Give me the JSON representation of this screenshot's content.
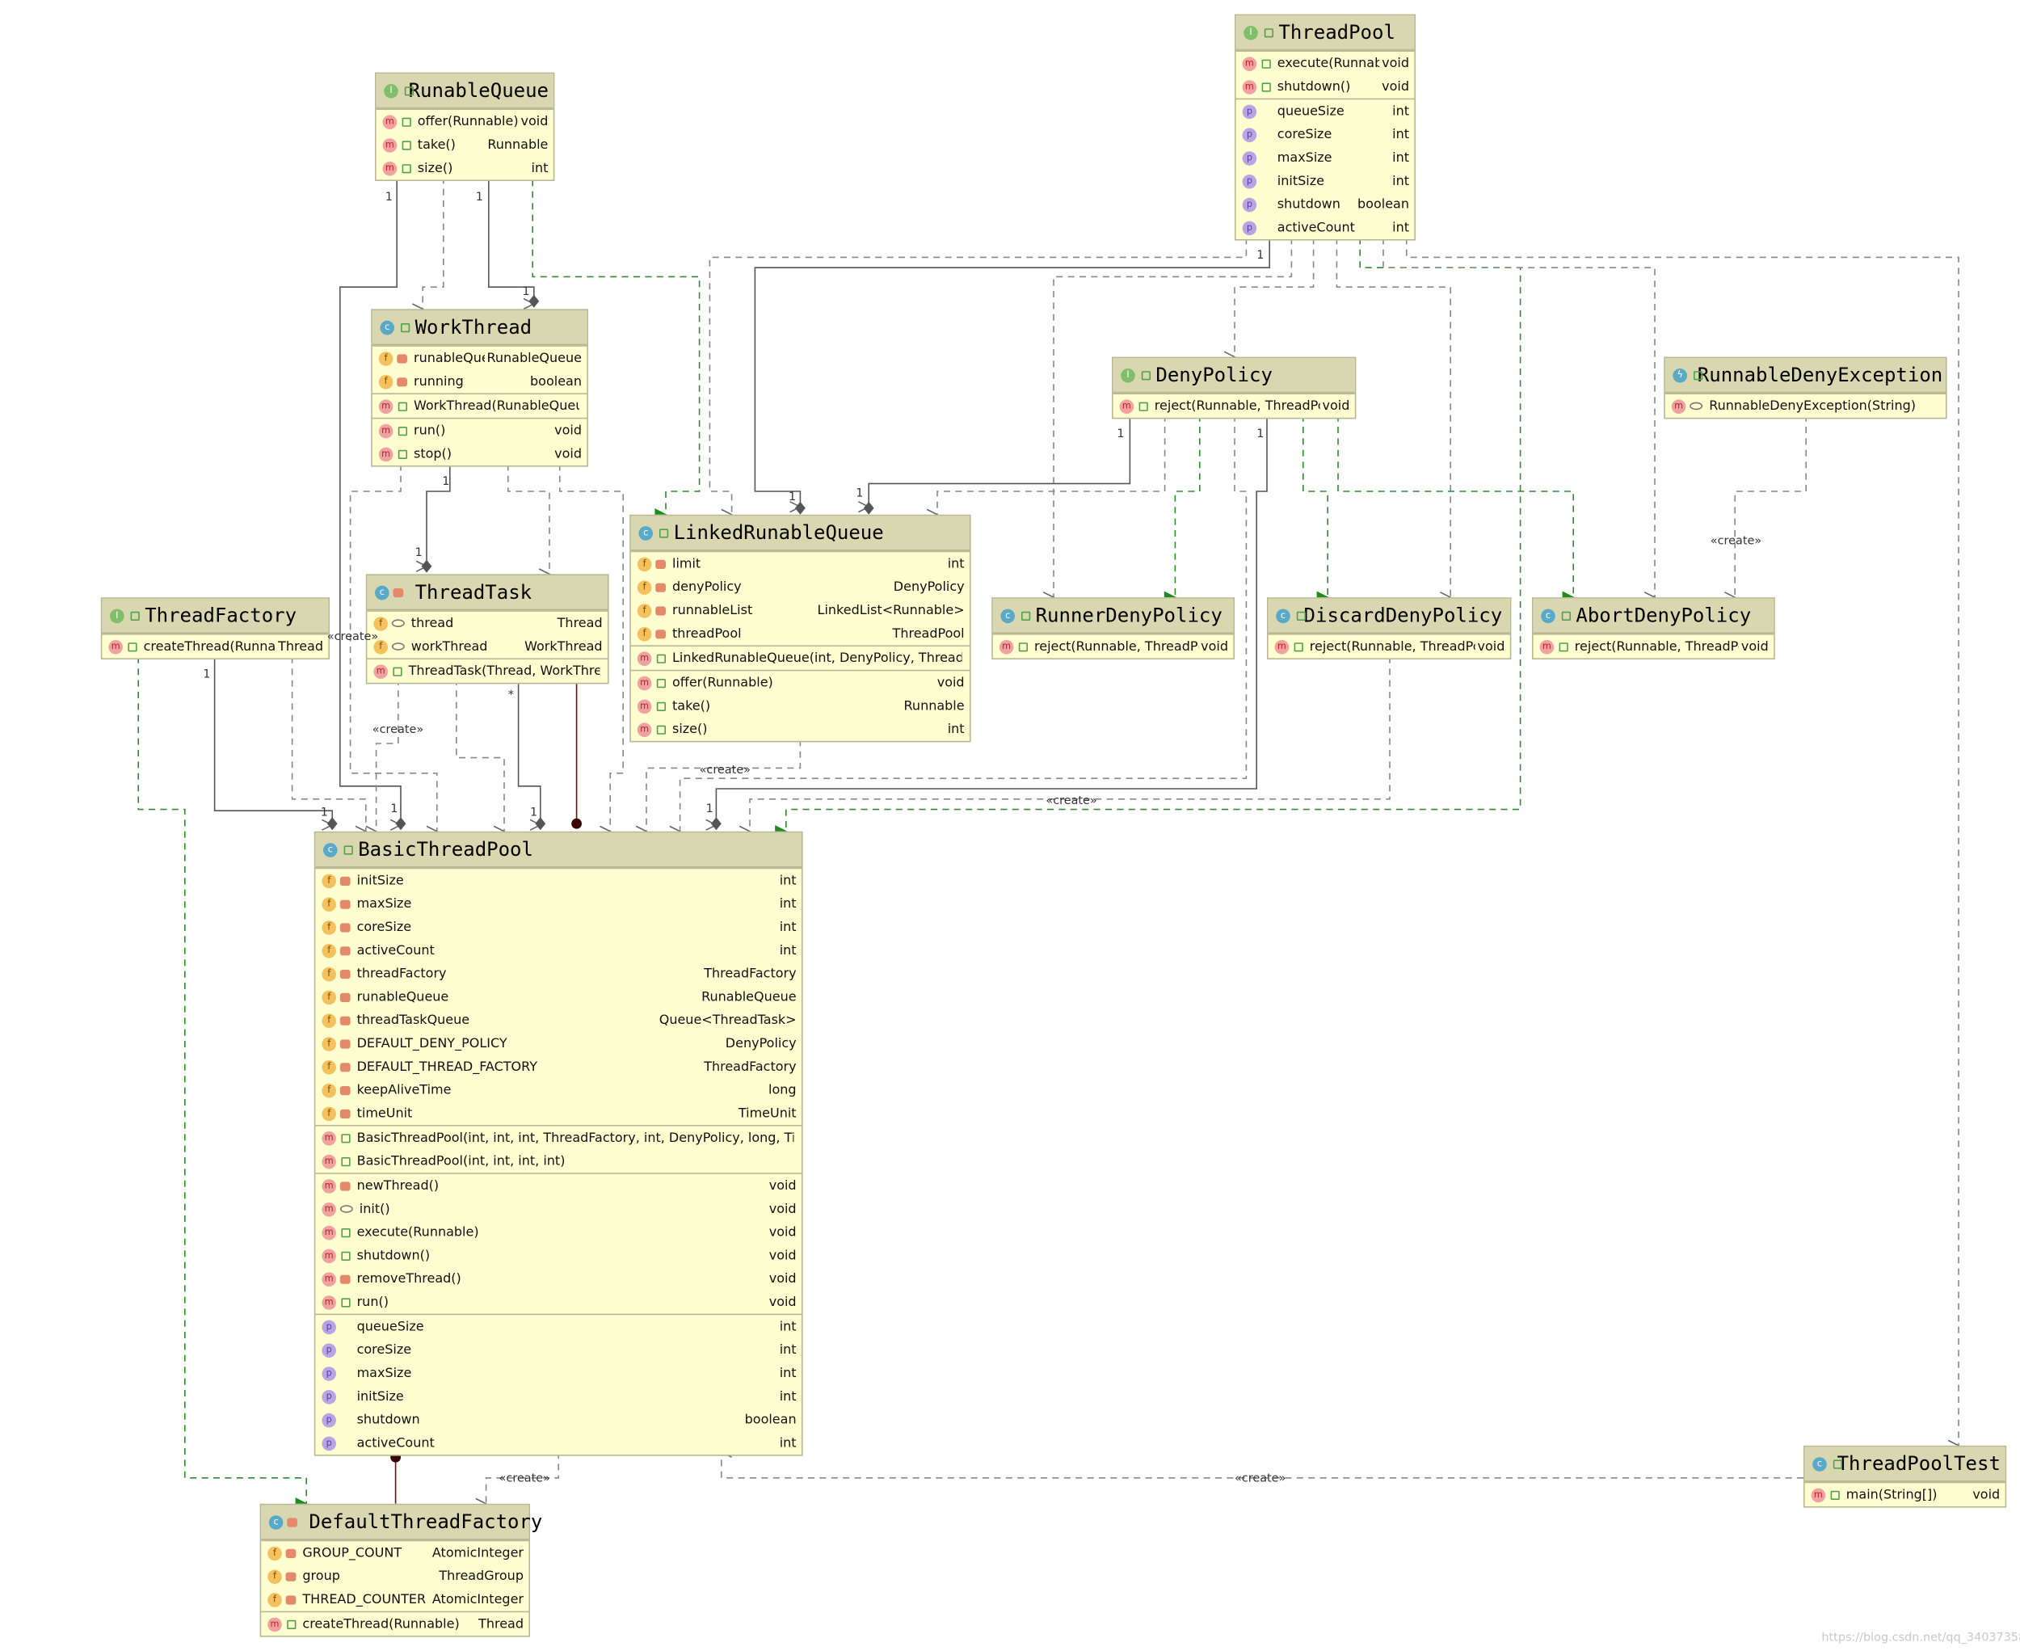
{
  "classes": [
    {
      "id": "RunableQueue",
      "name": "RunableQueue",
      "kind": "I",
      "sections": [
        [
          {
            "k": "m",
            "v": "public",
            "n": "offer(Runnable)",
            "t": "void"
          },
          {
            "k": "m",
            "v": "public",
            "n": "take()",
            "t": "Runnable"
          },
          {
            "k": "m",
            "v": "public",
            "n": "size()",
            "t": "int"
          }
        ]
      ]
    },
    {
      "id": "ThreadPool",
      "name": "ThreadPool",
      "kind": "I",
      "sections": [
        [
          {
            "k": "m",
            "v": "public",
            "n": "execute(Runnable)",
            "t": "void"
          },
          {
            "k": "m",
            "v": "public",
            "n": "shutdown()",
            "t": "void"
          }
        ],
        [
          {
            "k": "p",
            "v": "",
            "n": "queueSize",
            "t": "int"
          },
          {
            "k": "p",
            "v": "",
            "n": "coreSize",
            "t": "int"
          },
          {
            "k": "p",
            "v": "",
            "n": "maxSize",
            "t": "int"
          },
          {
            "k": "p",
            "v": "",
            "n": "initSize",
            "t": "int"
          },
          {
            "k": "p",
            "v": "",
            "n": "shutdown",
            "t": "boolean"
          },
          {
            "k": "p",
            "v": "",
            "n": "activeCount",
            "t": "int"
          }
        ]
      ]
    },
    {
      "id": "WorkThread",
      "name": "WorkThread",
      "kind": "C",
      "sections": [
        [
          {
            "k": "f",
            "v": "private",
            "n": "runableQueue",
            "t": "RunableQueue"
          },
          {
            "k": "f",
            "v": "private",
            "n": "running",
            "t": "boolean"
          }
        ],
        [
          {
            "k": "m",
            "v": "public",
            "n": "WorkThread(RunableQueue)",
            "t": ""
          }
        ],
        [
          {
            "k": "m",
            "v": "public",
            "n": "run()",
            "t": "void"
          },
          {
            "k": "m",
            "v": "public",
            "n": "stop()",
            "t": "void"
          }
        ]
      ]
    },
    {
      "id": "DenyPolicy",
      "name": "DenyPolicy",
      "kind": "I",
      "sections": [
        [
          {
            "k": "m",
            "v": "public",
            "n": "reject(Runnable, ThreadPool)",
            "t": "void"
          }
        ]
      ]
    },
    {
      "id": "RunnableDenyException",
      "name": "RunnableDenyException",
      "kind": "E",
      "sections": [
        [
          {
            "k": "m",
            "v": "package",
            "n": "RunnableDenyException(String)",
            "t": ""
          }
        ]
      ]
    },
    {
      "id": "LinkedRunableQueue",
      "name": "LinkedRunableQueue",
      "kind": "C",
      "sections": [
        [
          {
            "k": "f",
            "v": "private",
            "n": "limit",
            "t": "int"
          },
          {
            "k": "f",
            "v": "private",
            "n": "denyPolicy",
            "t": "DenyPolicy"
          },
          {
            "k": "f",
            "v": "private",
            "n": "runnableList",
            "t": "LinkedList<Runnable>"
          },
          {
            "k": "f",
            "v": "private",
            "n": "threadPool",
            "t": "ThreadPool"
          }
        ],
        [
          {
            "k": "m",
            "v": "public",
            "n": "LinkedRunableQueue(int, DenyPolicy, ThreadPool)",
            "t": ""
          }
        ],
        [
          {
            "k": "m",
            "v": "public",
            "n": "offer(Runnable)",
            "t": "void"
          },
          {
            "k": "m",
            "v": "public",
            "n": "take()",
            "t": "Runnable"
          },
          {
            "k": "m",
            "v": "public",
            "n": "size()",
            "t": "int"
          }
        ]
      ]
    },
    {
      "id": "ThreadTask",
      "name": "ThreadTask",
      "kind": "C",
      "headVis": "private",
      "sections": [
        [
          {
            "k": "f",
            "v": "package",
            "n": "thread",
            "t": "Thread"
          },
          {
            "k": "f",
            "v": "package",
            "n": "workThread",
            "t": "WorkThread"
          }
        ],
        [
          {
            "k": "m",
            "v": "public",
            "n": "ThreadTask(Thread, WorkThread)",
            "t": ""
          }
        ]
      ]
    },
    {
      "id": "ThreadFactory",
      "name": "ThreadFactory",
      "kind": "I",
      "sections": [
        [
          {
            "k": "m",
            "v": "public",
            "n": "createThread(Runnable)",
            "t": "Thread"
          }
        ]
      ]
    },
    {
      "id": "RunnerDenyPolicy",
      "name": "RunnerDenyPolicy",
      "kind": "C",
      "sections": [
        [
          {
            "k": "m",
            "v": "public",
            "n": "reject(Runnable, ThreadPool)",
            "t": "void"
          }
        ]
      ]
    },
    {
      "id": "DiscardDenyPolicy",
      "name": "DiscardDenyPolicy",
      "kind": "C",
      "sections": [
        [
          {
            "k": "m",
            "v": "public",
            "n": "reject(Runnable, ThreadPool)",
            "t": "void"
          }
        ]
      ]
    },
    {
      "id": "AbortDenyPolicy",
      "name": "AbortDenyPolicy",
      "kind": "C",
      "sections": [
        [
          {
            "k": "m",
            "v": "public",
            "n": "reject(Runnable, ThreadPool)",
            "t": "void"
          }
        ]
      ]
    },
    {
      "id": "BasicThreadPool",
      "name": "BasicThreadPool",
      "kind": "C",
      "sections": [
        [
          {
            "k": "f",
            "v": "private",
            "n": "initSize",
            "t": "int"
          },
          {
            "k": "f",
            "v": "private",
            "n": "maxSize",
            "t": "int"
          },
          {
            "k": "f",
            "v": "private",
            "n": "coreSize",
            "t": "int"
          },
          {
            "k": "f",
            "v": "private",
            "n": "activeCount",
            "t": "int"
          },
          {
            "k": "f",
            "v": "private",
            "n": "threadFactory",
            "t": "ThreadFactory"
          },
          {
            "k": "f",
            "v": "private",
            "n": "runableQueue",
            "t": "RunableQueue"
          },
          {
            "k": "f",
            "v": "private",
            "n": "threadTaskQueue",
            "t": "Queue<ThreadTask>"
          },
          {
            "k": "f",
            "v": "private",
            "n": "DEFAULT_DENY_POLICY",
            "t": "DenyPolicy"
          },
          {
            "k": "f",
            "v": "private",
            "n": "DEFAULT_THREAD_FACTORY",
            "t": "ThreadFactory"
          },
          {
            "k": "f",
            "v": "private",
            "n": "keepAliveTime",
            "t": "long"
          },
          {
            "k": "f",
            "v": "private",
            "n": "timeUnit",
            "t": "TimeUnit"
          }
        ],
        [
          {
            "k": "m",
            "v": "public",
            "n": "BasicThreadPool(int, int, int, ThreadFactory, int, DenyPolicy, long, TimeUnit)",
            "t": ""
          },
          {
            "k": "m",
            "v": "public",
            "n": "BasicThreadPool(int, int, int, int)",
            "t": ""
          }
        ],
        [
          {
            "k": "m",
            "v": "private",
            "n": "newThread()",
            "t": "void"
          },
          {
            "k": "m",
            "v": "package",
            "n": "init()",
            "t": "void"
          },
          {
            "k": "m",
            "v": "public",
            "n": "execute(Runnable)",
            "t": "void"
          },
          {
            "k": "m",
            "v": "public",
            "n": "shutdown()",
            "t": "void"
          },
          {
            "k": "m",
            "v": "private",
            "n": "removeThread()",
            "t": "void"
          },
          {
            "k": "m",
            "v": "public",
            "n": "run()",
            "t": "void"
          }
        ],
        [
          {
            "k": "p",
            "v": "",
            "n": "queueSize",
            "t": "int"
          },
          {
            "k": "p",
            "v": "",
            "n": "coreSize",
            "t": "int"
          },
          {
            "k": "p",
            "v": "",
            "n": "maxSize",
            "t": "int"
          },
          {
            "k": "p",
            "v": "",
            "n": "initSize",
            "t": "int"
          },
          {
            "k": "p",
            "v": "",
            "n": "shutdown",
            "t": "boolean"
          },
          {
            "k": "p",
            "v": "",
            "n": "activeCount",
            "t": "int"
          }
        ]
      ]
    },
    {
      "id": "ThreadPoolTest",
      "name": "ThreadPoolTest",
      "kind": "C",
      "sections": [
        [
          {
            "k": "m",
            "v": "public",
            "n": "main(String[])",
            "t": "void"
          }
        ]
      ]
    },
    {
      "id": "DefaultThreadFactory",
      "name": "DefaultThreadFactory",
      "kind": "C",
      "headVis": "private",
      "sections": [
        [
          {
            "k": "f",
            "v": "private",
            "n": "GROUP_COUNT",
            "t": "AtomicInteger"
          },
          {
            "k": "f",
            "v": "private",
            "n": "group",
            "t": "ThreadGroup"
          },
          {
            "k": "f",
            "v": "private",
            "n": "THREAD_COUNTER",
            "t": "AtomicInteger"
          }
        ],
        [
          {
            "k": "m",
            "v": "public",
            "n": "createThread(Runnable)",
            "t": "Thread"
          }
        ]
      ]
    }
  ],
  "labels": {
    "create": "«create»",
    "one": "1",
    "many": "*"
  },
  "watermark": "https://blog.csdn.net/qq_34037358",
  "colors": {
    "class_fill": "#fefed0",
    "header_fill": "#d8d7b0",
    "border": "#b8b896",
    "dependency_line": "#888888",
    "association_line": "#555555",
    "realization_line": "#2e8b2e",
    "inner_class_line": "#8b0000"
  }
}
